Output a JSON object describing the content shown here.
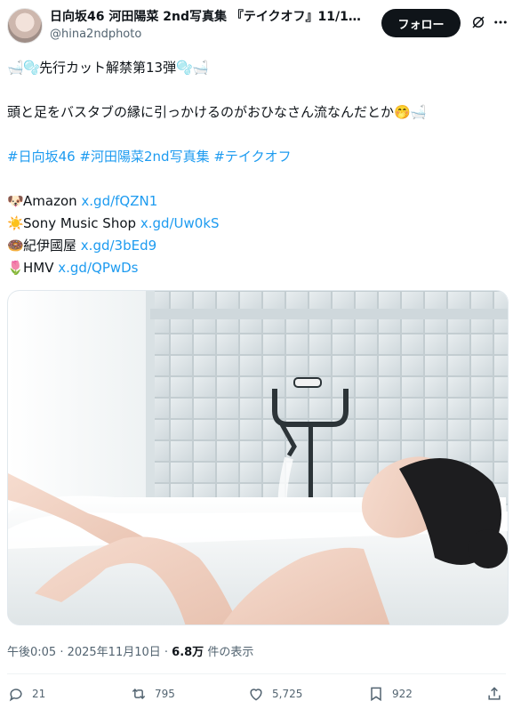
{
  "post": {
    "author": {
      "display_name": "日向坂46 河田陽菜 2nd写真集 『テイクオフ』11/1…",
      "handle": "@hina2ndphoto",
      "avatar_icon": "avatar-photo"
    },
    "follow_label": "フォロー",
    "text": {
      "line1": "先行カット解禁第13弾",
      "line2": "頭と足をバスタブの縁に引っかけるのがおひなさん流なんだとか",
      "hashtags": "#日向坂46 #河田陽菜2nd写真集 #テイクオフ",
      "shops": [
        {
          "icon": "🐶",
          "name": "Amazon",
          "url": "x.gd/fQZN1"
        },
        {
          "icon": "☀️",
          "name": "Sony Music Shop",
          "url": "x.gd/Uw0kS"
        },
        {
          "icon": "🍩",
          "name": "紀伊國屋",
          "url": "x.gd/3bEd9"
        },
        {
          "icon": "🌷",
          "name": "HMV",
          "url": "x.gd/QPwDs"
        }
      ]
    },
    "meta": {
      "time": "午後0:05 · 2025年11月10日 · ",
      "views": "6.8万",
      "views_suffix": " 件の表示"
    },
    "actions": {
      "replies": "21",
      "reposts": "795",
      "likes": "5,725",
      "bookmarks": "922"
    }
  },
  "colors": {
    "link": "#1d9bf0",
    "text": "#0f1419",
    "muted": "#536471"
  }
}
